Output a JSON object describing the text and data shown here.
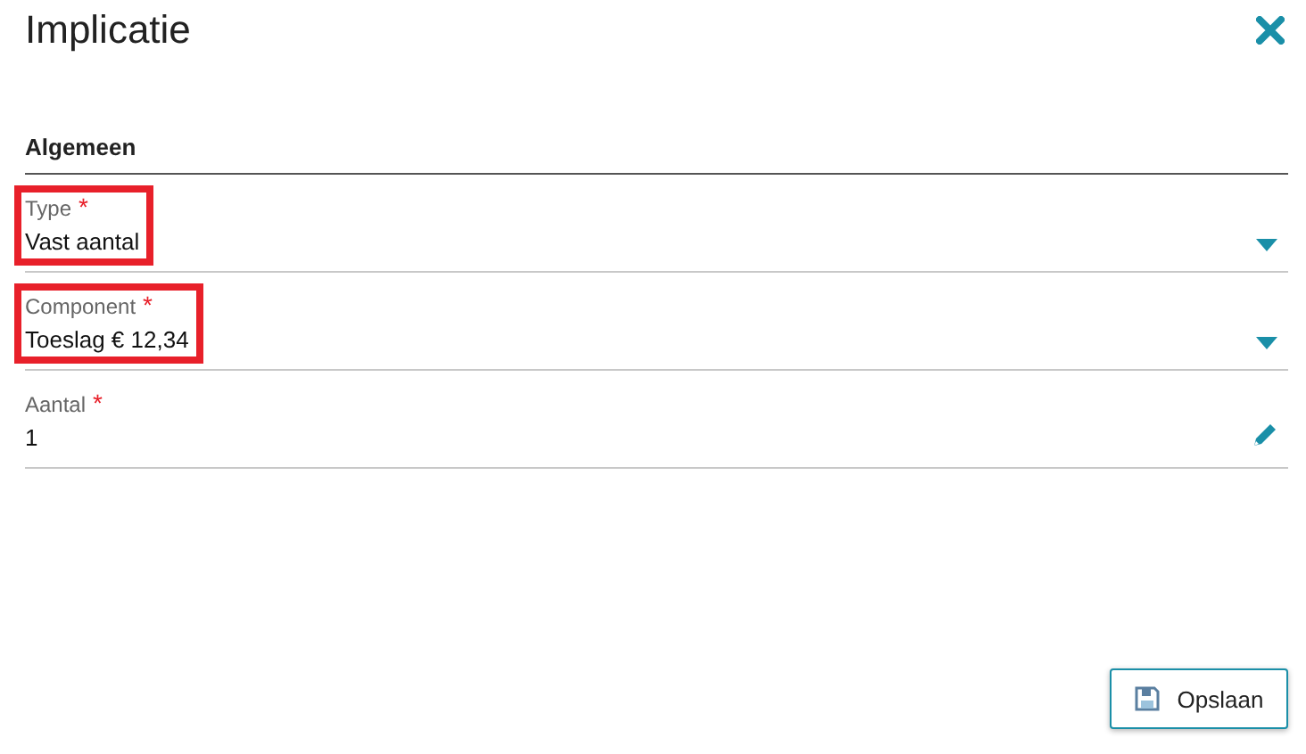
{
  "dialog": {
    "title": "Implicatie"
  },
  "section": {
    "title": "Algemeen"
  },
  "fields": [
    {
      "label": "Type",
      "required": true,
      "value": "Vast aantal",
      "kind": "select",
      "highlighted": true
    },
    {
      "label": "Component",
      "required": true,
      "value": "Toeslag € 12,34",
      "kind": "select",
      "highlighted": true
    },
    {
      "label": "Aantal",
      "required": true,
      "value": "1",
      "kind": "text",
      "highlighted": false
    }
  ],
  "required_mark": "*",
  "buttons": [
    {
      "label": "Opslaan"
    }
  ]
}
